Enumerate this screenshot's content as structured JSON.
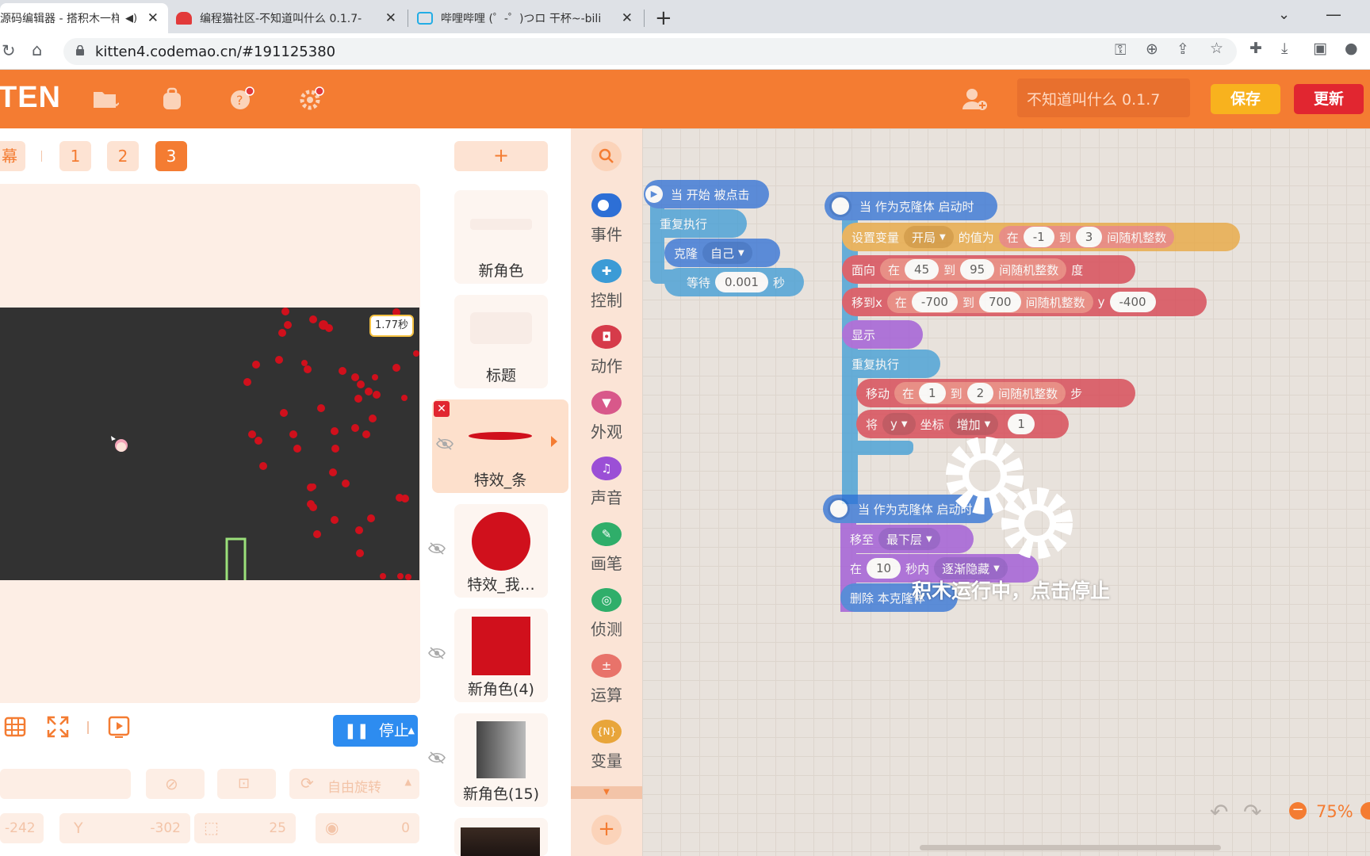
{
  "browser": {
    "tabs": [
      {
        "title": "源码编辑器 - 搭积木一样"
      },
      {
        "title": "编程猫社区-不知道叫什么 0.1.7-"
      },
      {
        "title": "哔哩哔哩 (゜-゜)つロ 干杯~-bili"
      }
    ],
    "url": "kitten4.codemao.cn/#191125380"
  },
  "header": {
    "logo": "TEN",
    "project_name": "不知道叫什么 0.1.7",
    "save_label": "保存",
    "update_label": "更新"
  },
  "stage": {
    "scene_partial": "幕",
    "scenes": [
      "1",
      "2",
      "3"
    ],
    "active_scene": "3",
    "timer": "1.77秒",
    "stop_label": "停止",
    "props": {
      "x": "-242",
      "y_label": "Y",
      "y": "-302",
      "size": "25",
      "direction": "0",
      "rotate_mode": "自由旋转"
    }
  },
  "sprites": {
    "add_label": "+",
    "items": [
      {
        "name": "新角色"
      },
      {
        "name": "标题"
      },
      {
        "name": "特效_条"
      },
      {
        "name": "特效_我…"
      },
      {
        "name": "新角色(4)"
      },
      {
        "name": "新角色(15)"
      }
    ]
  },
  "categories": [
    {
      "label": "事件",
      "color": "#2d6fd6"
    },
    {
      "label": "控制",
      "color": "#3b9bd6"
    },
    {
      "label": "动作",
      "color": "#d63b4a"
    },
    {
      "label": "外观",
      "color": "#d8588a"
    },
    {
      "label": "声音",
      "color": "#9b4fd6"
    },
    {
      "label": "画笔",
      "color": "#2fae6a"
    },
    {
      "label": "侦测",
      "color": "#2fae6a"
    },
    {
      "label": "运算",
      "color": "#e8736a"
    },
    {
      "label": "变量",
      "color": "#e8a53a"
    }
  ],
  "workspace": {
    "script1": {
      "hat": "当 开始 被点击",
      "repeat": "重复执行",
      "clone": "克隆",
      "clone_target": "自己",
      "wait": "等待",
      "wait_value": "0.001",
      "wait_unit": "秒"
    },
    "script2": {
      "hat": "当 作为克隆体 启动时",
      "setvar": "设置变量",
      "var_name": "开局",
      "var_of": "的值为",
      "in": "在",
      "rand_a1": "-1",
      "to": "到",
      "rand_b1": "3",
      "rand_label": "间随机整数",
      "face": "面向",
      "face_a": "45",
      "face_b": "95",
      "deg": "度",
      "moveto": "移到x",
      "mx_a": "-700",
      "mx_b": "700",
      "y_lbl": "y",
      "my": "-400",
      "show": "显示",
      "repeat": "重复执行",
      "move": "移动",
      "mv_a": "1",
      "mv_b": "2",
      "step": "步",
      "set": "将",
      "axis": "y",
      "coord": "坐标",
      "op": "增加",
      "op_val": "1"
    },
    "script3": {
      "hat": "当 作为克隆体 启动时",
      "moveto": "移至",
      "layer": "最下层",
      "in": "在",
      "secs": "10",
      "within": "秒内",
      "effect": "逐渐隐藏",
      "delete": "删除 本克隆体"
    },
    "running_text": "积木运行中，点击停止",
    "zoom": "75%"
  }
}
